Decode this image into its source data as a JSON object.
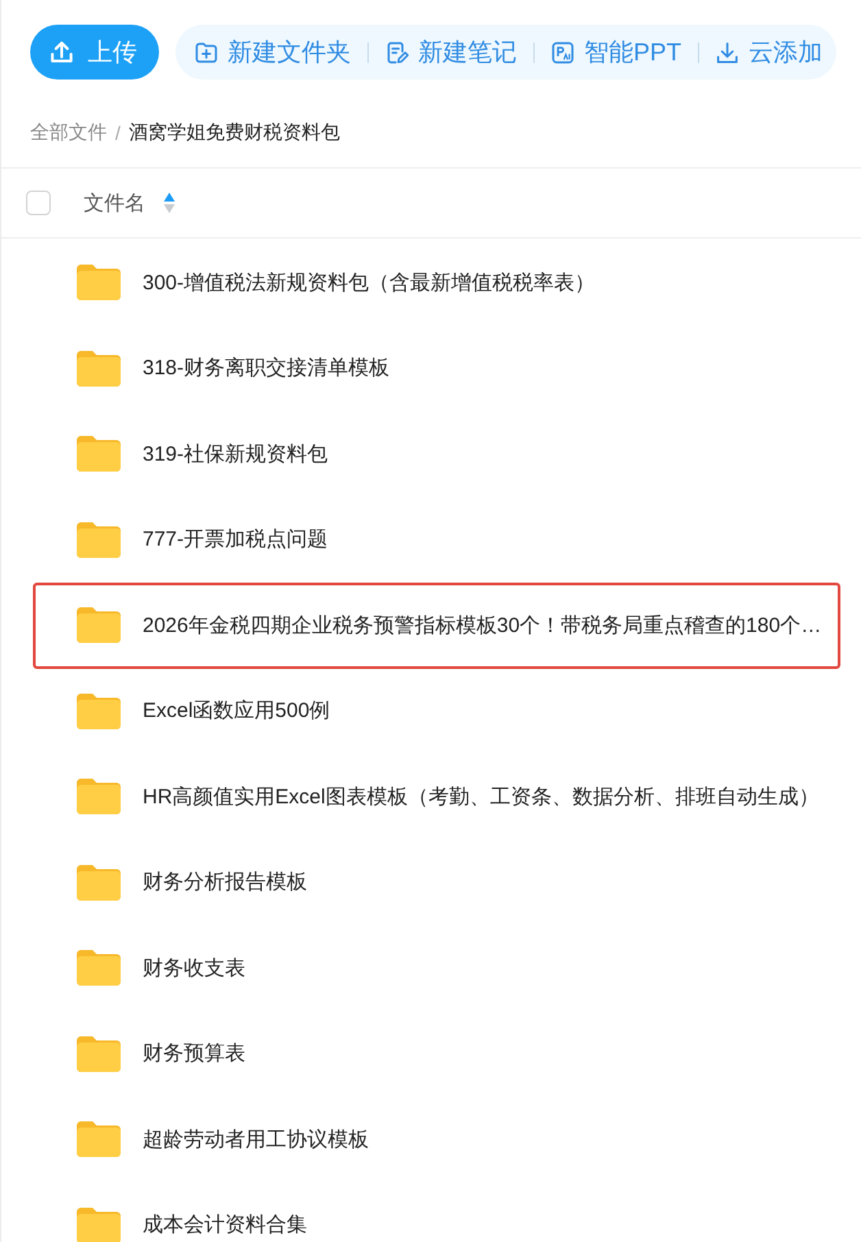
{
  "toolbar": {
    "upload_button": "上传",
    "actions": [
      {
        "kind": "new-folder",
        "label": "新建文件夹"
      },
      {
        "kind": "new-note",
        "label": "新建笔记"
      },
      {
        "kind": "smart-ppt",
        "label": "智能PPT"
      },
      {
        "kind": "cloud-add",
        "label": "云添加"
      }
    ]
  },
  "breadcrumb": {
    "separator": "/",
    "items": [
      {
        "label": "全部文件",
        "selected": false
      },
      {
        "label": "酒窝学姐免费财税资料包",
        "selected": true
      }
    ]
  },
  "file_list": {
    "header": {
      "checked": false,
      "column": "文件名",
      "sorted_ascending": true
    },
    "rows": [
      {
        "name": "300-增值税法新规资料包（含最新增值税税率表）",
        "highlighted": false
      },
      {
        "name": "318-财务离职交接清单模板",
        "highlighted": false
      },
      {
        "name": "319-社保新规资料包",
        "highlighted": false
      },
      {
        "name": "777-开票加税点问题",
        "highlighted": false
      },
      {
        "name": "2026年金税四期企业税务预警指标模板30个！带税务局重点稽查的180个…",
        "highlighted": true
      },
      {
        "name": "Excel函数应用500例",
        "highlighted": false
      },
      {
        "name": "HR高颜值实用Excel图表模板（考勤、工资条、数据分析、排班自动生成）",
        "highlighted": false
      },
      {
        "name": "财务分析报告模板",
        "highlighted": false
      },
      {
        "name": "财务收支表",
        "highlighted": false
      },
      {
        "name": "财务预算表",
        "highlighted": false
      },
      {
        "name": "超龄劳动者用工协议模板",
        "highlighted": false
      },
      {
        "name": "成本会计资料合集",
        "highlighted": false
      }
    ]
  }
}
